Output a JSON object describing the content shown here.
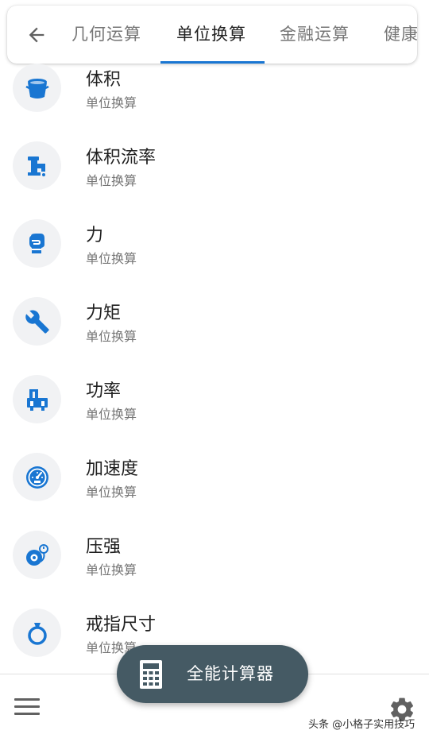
{
  "tabs": [
    {
      "label": "几何运算",
      "active": false
    },
    {
      "label": "单位换算",
      "active": true
    },
    {
      "label": "金融运算",
      "active": false
    },
    {
      "label": "健康",
      "active": false
    }
  ],
  "list": [
    {
      "title": "体积",
      "subtitle": "单位换算",
      "icon": "bucket-icon"
    },
    {
      "title": "体积流率",
      "subtitle": "单位换算",
      "icon": "faucet-icon"
    },
    {
      "title": "力",
      "subtitle": "单位换算",
      "icon": "boxing-glove-icon"
    },
    {
      "title": "力矩",
      "subtitle": "单位换算",
      "icon": "wrench-icon"
    },
    {
      "title": "功率",
      "subtitle": "单位换算",
      "icon": "engine-icon"
    },
    {
      "title": "加速度",
      "subtitle": "单位换算",
      "icon": "speedometer-icon"
    },
    {
      "title": "压强",
      "subtitle": "单位换算",
      "icon": "tire-pressure-icon"
    },
    {
      "title": "戒指尺寸",
      "subtitle": "单位换算",
      "icon": "ring-icon"
    }
  ],
  "fab": {
    "label": "全能计算器",
    "icon": "calculator-icon"
  },
  "watermark": "头条 @小格子实用技巧",
  "colors": {
    "accent": "#1976d2",
    "fab": "#455a64",
    "icon": "#1976d2"
  }
}
